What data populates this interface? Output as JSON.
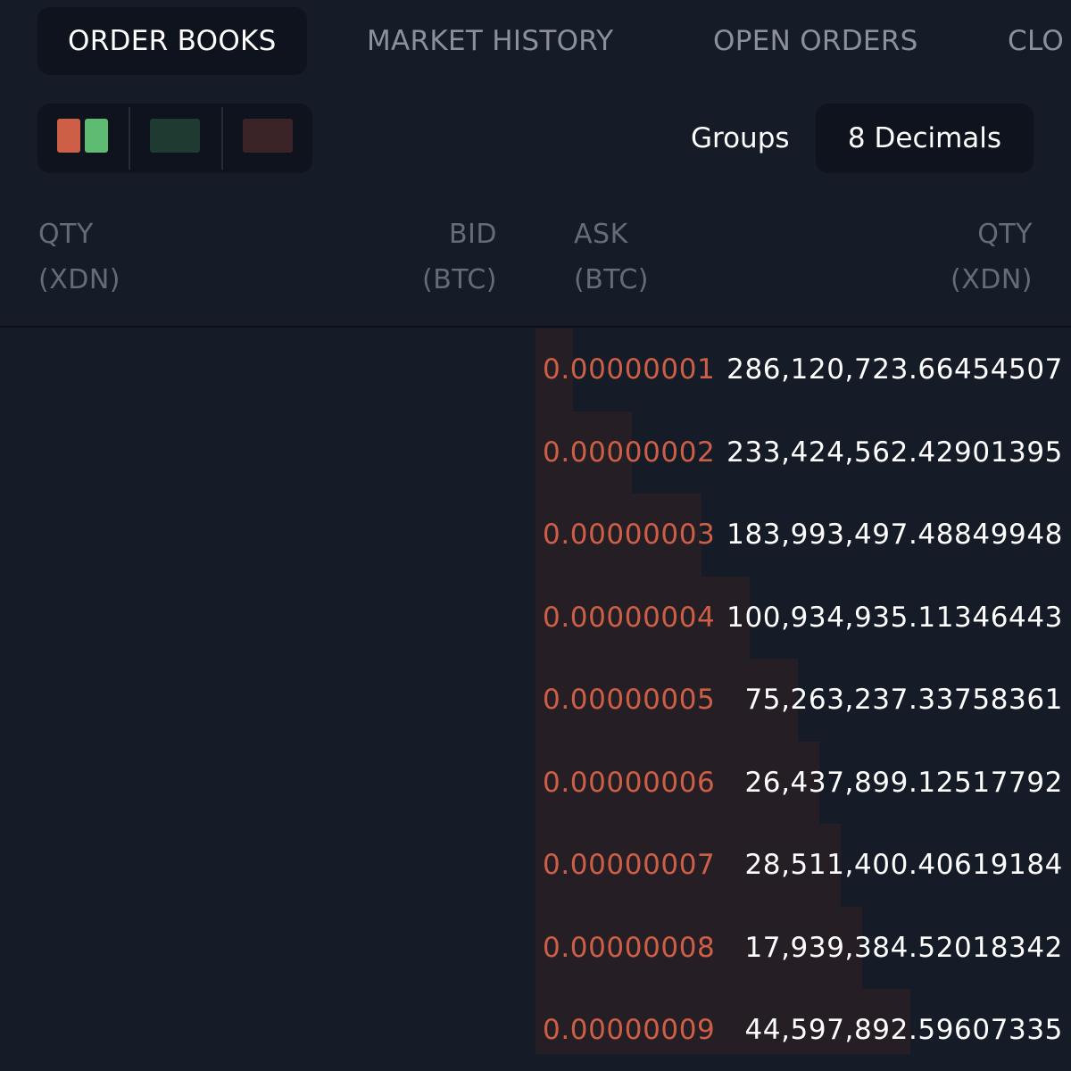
{
  "tabs": [
    {
      "label": "ORDER BOOKS",
      "active": true
    },
    {
      "label": "MARKET HISTORY",
      "active": false
    },
    {
      "label": "OPEN ORDERS",
      "active": false
    },
    {
      "label": "CLO",
      "active": false
    }
  ],
  "toolbar": {
    "view_modes": [
      "both-sides",
      "bids-only",
      "asks-only"
    ],
    "groups_label": "Groups",
    "decimals_label": "8 Decimals"
  },
  "columns": {
    "bid_qty": {
      "line1": "QTY",
      "line2": "(XDN)"
    },
    "bid_price": {
      "line1": "BID",
      "line2": "(BTC)"
    },
    "ask_price": {
      "line1": "ASK",
      "line2": "(BTC)"
    },
    "ask_qty": {
      "line1": "QTY",
      "line2": "(XDN)"
    }
  },
  "colors": {
    "ask": "#cc5f45",
    "bid": "#5dbb72",
    "depth": "#251e25",
    "background": "#151b27",
    "panel": "#0e131d"
  },
  "asks": [
    {
      "price": "0.00000001",
      "qty": "286,120,723.66454507",
      "depth_pct": 7
    },
    {
      "price": "0.00000002",
      "qty": "233,424,562.42901395",
      "depth_pct": 18
    },
    {
      "price": "0.00000003",
      "qty": "183,993,497.48849948",
      "depth_pct": 31
    },
    {
      "price": "0.00000004",
      "qty": "100,934,935.11346443",
      "depth_pct": 40
    },
    {
      "price": "0.00000005",
      "qty": "75,263,237.33758361",
      "depth_pct": 49
    },
    {
      "price": "0.00000006",
      "qty": "26,437,899.12517792",
      "depth_pct": 53
    },
    {
      "price": "0.00000007",
      "qty": "28,511,400.40619184",
      "depth_pct": 57
    },
    {
      "price": "0.00000008",
      "qty": "17,939,384.52018342",
      "depth_pct": 61
    },
    {
      "price": "0.00000009",
      "qty": "44,597,892.59607335",
      "depth_pct": 70
    }
  ]
}
